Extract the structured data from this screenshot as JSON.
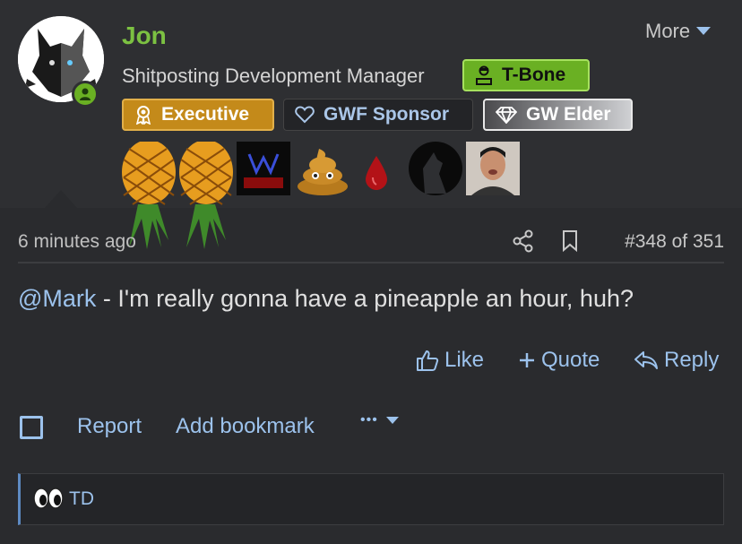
{
  "user": {
    "name": "Jon",
    "title": "Shitposting Development Manager",
    "more_label": "More"
  },
  "badges": [
    {
      "label": "T-Bone",
      "icon": "user-badge-icon"
    },
    {
      "label": "Executive",
      "icon": "award-icon"
    },
    {
      "label": "GWF Sponsor",
      "icon": "heart-icon"
    },
    {
      "label": "GW Elder",
      "icon": "diamond-icon"
    }
  ],
  "trophies": [
    "pineapple",
    "pineapple",
    "butts-badge",
    "poop-emoji",
    "blood-drop",
    "wolf-silhouette",
    "man-photo"
  ],
  "post": {
    "time": "6 minutes ago",
    "number": "#348 of 351",
    "mention": "@Mark",
    "text": " - I'm really gonna have a pineapple an hour, huh?"
  },
  "actions": {
    "like": "Like",
    "quote": "Quote",
    "reply": "Reply"
  },
  "footer": {
    "report": "Report",
    "add_bookmark": "Add bookmark",
    "more_dots": "•••"
  },
  "reactions": {
    "emoji": "eyes-icon",
    "names": "TD"
  },
  "colors": {
    "background": "#2a2b2e",
    "username": "#7cc142",
    "link": "#9cc2ec",
    "tbone": "#6ab023",
    "executive": "#c48a1a"
  }
}
